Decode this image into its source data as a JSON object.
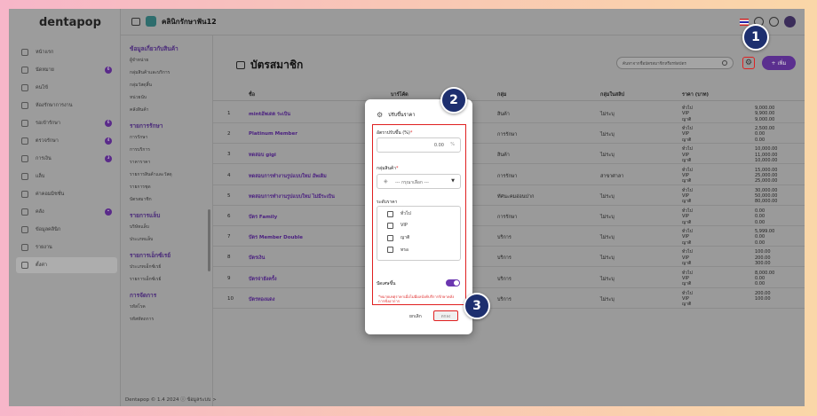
{
  "brand": "dentapop",
  "header": {
    "clinic_name": "คลินิกรักษาฟัน12"
  },
  "sidebar": {
    "items": [
      {
        "label": "หน้าแรก",
        "icon": "home-icon",
        "badge": ""
      },
      {
        "label": "นัดหมาย",
        "icon": "calendar-icon",
        "badge": "6"
      },
      {
        "label": "คนไข้",
        "icon": "patient-icon",
        "badge": ""
      },
      {
        "label": "ห้องรักษาการงาน",
        "icon": "room-icon",
        "badge": ""
      },
      {
        "label": "รอเข้ารักษา",
        "icon": "queue-icon",
        "badge": "6"
      },
      {
        "label": "ตรวจรักษา",
        "icon": "treatment-icon",
        "badge": "4"
      },
      {
        "label": "การเงิน",
        "icon": "finance-icon",
        "badge": "3"
      },
      {
        "label": "แล็บ",
        "icon": "lab-icon",
        "badge": ""
      },
      {
        "label": "ค่าคอมมิชชั่น",
        "icon": "percent-icon",
        "badge": ""
      },
      {
        "label": "คลัง",
        "icon": "inventory-icon",
        "badge": "•"
      },
      {
        "label": "ข้อมูลคลินิก",
        "icon": "info-icon",
        "badge": ""
      },
      {
        "label": "รายงาน",
        "icon": "report-icon",
        "badge": ""
      },
      {
        "label": "ตั้งค่า",
        "icon": "settings-icon",
        "badge": ""
      }
    ],
    "footer": "Dentapop © 1.4 2024  ⓘ ข้อมูลระบบ >"
  },
  "submenu": {
    "groups": [
      {
        "title": "ข้อมูลเกี่ยวกับสินค้า",
        "items": [
          "ผู้จำหน่าย",
          "กลุ่มสินค้าและบริการ",
          "กลุ่มวัสดุสิ้น",
          "หน่วยนับ",
          "คลังสินค้า"
        ]
      },
      {
        "title": "รายการรักษา",
        "items": [
          "การรักษา",
          "การบริการ",
          "ราคาราคา",
          "รายการสินค้าและวัสดุ",
          "รายการชุด",
          "บัตรสมาชิก"
        ]
      },
      {
        "title": "รายการแล็บ",
        "items": [
          "บริษัทแล็บ",
          "ประเภทแล็บ"
        ]
      },
      {
        "title": "รายการเอ็กซ์เรย์",
        "items": [
          "ประเภทเอ็กซ์เรย์",
          "รายการเอ็กซ์เรย์"
        ]
      },
      {
        "title": "การจัดการ",
        "items": [
          "รหัสโรค",
          "รหัสหัตถการ"
        ]
      }
    ]
  },
  "page": {
    "title": "บัตรสมาชิก",
    "search_placeholder": "ค้นหาจากชื่อบัตรสมาชิกหรือรหัสบัตร",
    "add_label": "+ เพิ่ม"
  },
  "table": {
    "headers": [
      "ชื่อ",
      "บาร์โค้ด",
      "กลุ่ม",
      "กลุ่มในสลิป",
      "ราคา (บาท)"
    ],
    "tiers": [
      "ทั่วไป",
      "VIP",
      "ญาติ"
    ],
    "rows": [
      {
        "no": "1",
        "name": "mintอัพเดต ระเบิน",
        "group": "สินค้า",
        "slip": "ไม่ระบุ",
        "prices": [
          "9,000.00",
          "9,900.00",
          "9,000.00"
        ]
      },
      {
        "no": "2",
        "name": "Platinum Member",
        "group": "การรักษา",
        "slip": "ไม่ระบุ",
        "prices": [
          "2,500.00",
          "0.00",
          "0.00"
        ]
      },
      {
        "no": "3",
        "name": "ทดสอบ gigi",
        "group": "สินค้า",
        "slip": "ไม่ระบุ",
        "prices": [
          "10,000.00",
          "11,000.00",
          "10,000.00"
        ]
      },
      {
        "no": "4",
        "name": "ทดสอบการทำงานรูปแบบใหม่ อัพเดิม",
        "group": "การรักษา",
        "slip": "สาขาศาลา",
        "prices": [
          "15,000.00",
          "25,000.00",
          "25,000.00"
        ]
      },
      {
        "no": "5",
        "name": "ทดสอบการทำงานรูปแบบใหม่ ไม่มีระเบิน",
        "group": "ทัศนะคมอ่อนปาก",
        "slip": "ไม่ระบุ",
        "prices": [
          "30,000.00",
          "50,000.00",
          "80,000.00"
        ]
      },
      {
        "no": "6",
        "name": "บัตร Family",
        "group": "การรักษา",
        "slip": "ไม่ระบุ",
        "prices": [
          "0.00",
          "0.00",
          "0.00"
        ]
      },
      {
        "no": "7",
        "name": "บัตร Member Double",
        "group": "บริการ",
        "slip": "ไม่ระบุ",
        "prices": [
          "5,999.00",
          "0.00",
          "0.00"
        ]
      },
      {
        "no": "8",
        "name": "บัตรเงิน",
        "group": "บริการ",
        "slip": "ไม่ระบุ",
        "prices": [
          "100.00",
          "200.00",
          "300.00"
        ]
      },
      {
        "no": "9",
        "name": "บัตรจ่ายังครั้ง",
        "group": "บริการ",
        "slip": "ไม่ระบุ",
        "prices": [
          "8,000.00",
          "0.00",
          "0.00"
        ]
      },
      {
        "no": "10",
        "name": "บัตรทองแดง",
        "group": "บริการ",
        "slip": "ไม่ระบุ",
        "prices": [
          "200.00",
          "100.00",
          ""
        ]
      }
    ]
  },
  "modal": {
    "title": "ปรับขึ้นราคา",
    "percent_label": "อัตราปรับขึ้น (%)",
    "percent_value": "0.00",
    "percent_unit": "%",
    "group_label": "กลุ่มสินค้า",
    "group_placeholder": "--- กรุณาเลือก ---",
    "tier_label": "ระดับราคา",
    "tiers": [
      "ทั่วไป",
      "VIP",
      "ญาติ",
      "ทรอ"
    ],
    "toggle_label": "ปัดเศษขึ้น",
    "note": "*หมายเหตุราคาเมื่อไม่มีผลบังคับรีการรักษาคลังการชั่งอาการ",
    "cancel_label": "ยกเลิก",
    "confirm_label": "ตกลง"
  },
  "steps": [
    "1",
    "2",
    "3"
  ],
  "colors": {
    "accent": "#5b2f8f",
    "highlight": "#e02020",
    "step": "#1d2f6f"
  }
}
